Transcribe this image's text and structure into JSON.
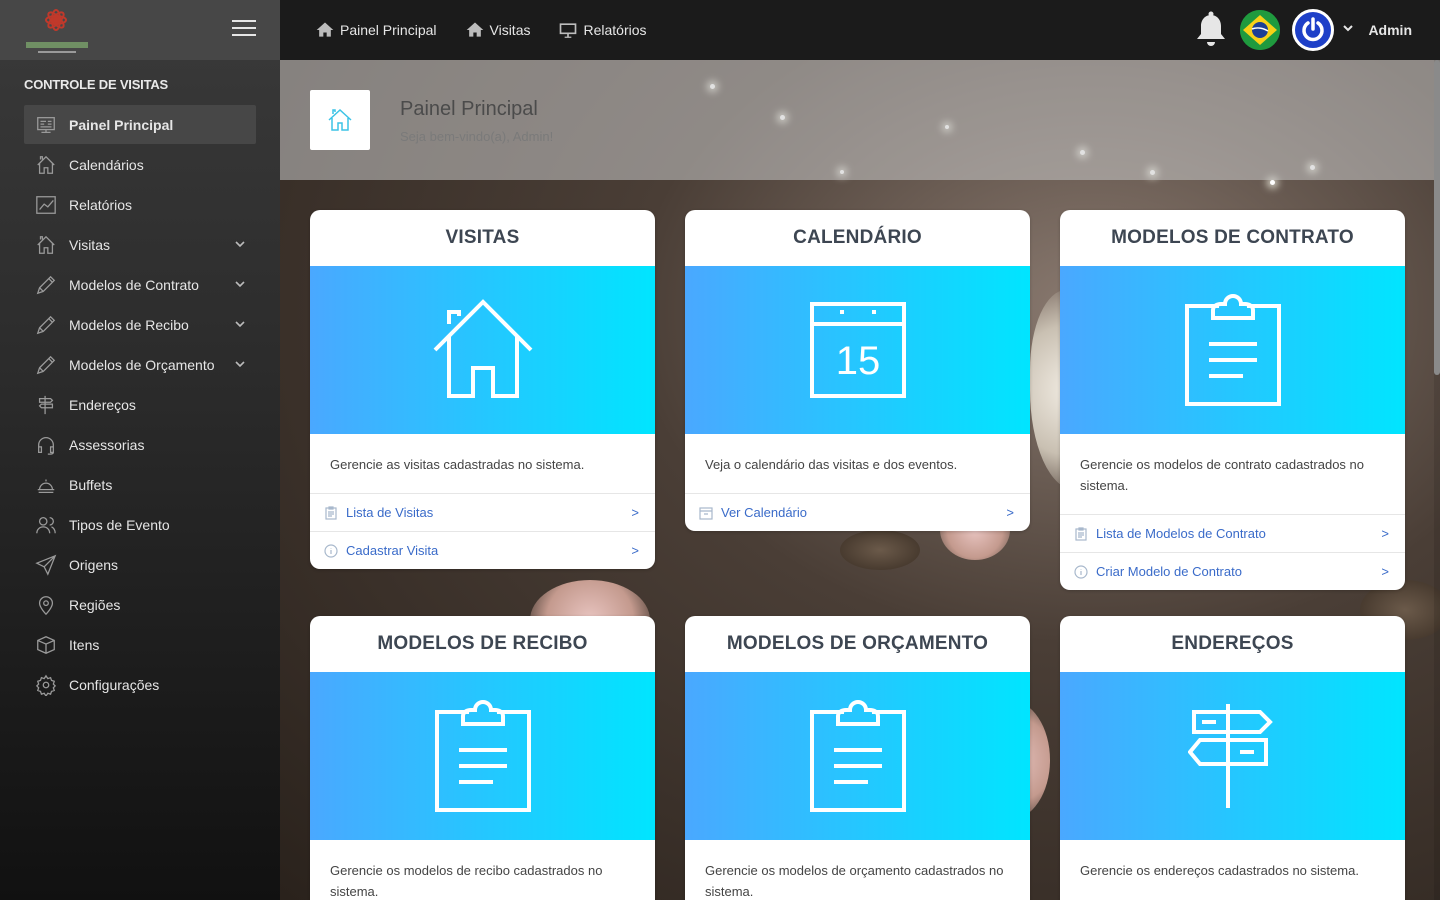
{
  "sidebar": {
    "heading": "CONTROLE DE VISITAS",
    "items": [
      {
        "label": "Painel Principal",
        "icon": "dashboard-icon",
        "active": true
      },
      {
        "label": "Calendários",
        "icon": "home-icon"
      },
      {
        "label": "Relatórios",
        "icon": "chart-icon"
      },
      {
        "label": "Visitas",
        "icon": "home-icon",
        "expandable": true
      },
      {
        "label": "Modelos de Contrato",
        "icon": "pencil-icon",
        "expandable": true
      },
      {
        "label": "Modelos de Recibo",
        "icon": "pencil-icon",
        "expandable": true
      },
      {
        "label": "Modelos de Orçamento",
        "icon": "pencil-icon",
        "expandable": true
      },
      {
        "label": "Endereços",
        "icon": "signpost-icon"
      },
      {
        "label": "Assessorias",
        "icon": "headset-icon"
      },
      {
        "label": "Buffets",
        "icon": "cloche-icon"
      },
      {
        "label": "Tipos de Evento",
        "icon": "people-icon"
      },
      {
        "label": "Origens",
        "icon": "send-icon"
      },
      {
        "label": "Regiões",
        "icon": "pin-icon"
      },
      {
        "label": "Itens",
        "icon": "box-icon"
      },
      {
        "label": "Configurações",
        "icon": "gear-icon"
      }
    ]
  },
  "topbar": {
    "nav": [
      {
        "label": "Painel Principal",
        "icon": "home-icon"
      },
      {
        "label": "Visitas",
        "icon": "home-icon"
      },
      {
        "label": "Relatórios",
        "icon": "monitor-icon"
      }
    ],
    "user": "Admin"
  },
  "header": {
    "title": "Painel Principal",
    "subtitle": "Seja bem-vindo(a), Admin!"
  },
  "cards": [
    {
      "title": "VISITAS",
      "icon": "house-icon",
      "desc": "Gerencie as visitas cadastradas no sistema.",
      "links": [
        {
          "label": "Lista de Visitas",
          "icon": "clipboard-icon",
          "arrow": ">"
        },
        {
          "label": "Cadastrar Visita",
          "icon": "info-icon",
          "arrow": ">"
        }
      ]
    },
    {
      "title": "CALENDÁRIO",
      "icon": "calendar-icon",
      "hero_number": "15",
      "desc": "Veja o calendário das visitas e dos eventos.",
      "links": [
        {
          "label": "Ver Calendário",
          "icon": "calendar-small-icon",
          "arrow": ">"
        }
      ]
    },
    {
      "title": "MODELOS DE CONTRATO",
      "icon": "clipboard-icon",
      "desc": "Gerencie os modelos de contrato cadastrados no sistema.",
      "links": [
        {
          "label": "Lista de Modelos de Contrato",
          "icon": "clipboard-icon",
          "arrow": ">"
        },
        {
          "label": "Criar Modelo de Contrato",
          "icon": "info-icon",
          "arrow": ">"
        }
      ]
    },
    {
      "title": "MODELOS DE RECIBO",
      "icon": "clipboard-icon",
      "desc": "Gerencie os modelos de recibo cadastrados no sistema."
    },
    {
      "title": "MODELOS DE ORÇAMENTO",
      "icon": "clipboard-icon",
      "desc": "Gerencie os modelos de orçamento cadastrados no sistema."
    },
    {
      "title": "ENDEREÇOS",
      "icon": "signpost-icon",
      "desc": "Gerencie os endereços cadastrados no sistema."
    }
  ],
  "colors": {
    "hero_gradient_start": "#4aa8ff",
    "hero_gradient_end": "#00e5ff",
    "link": "#3a6bc9",
    "power_button": "#1e40c8"
  }
}
